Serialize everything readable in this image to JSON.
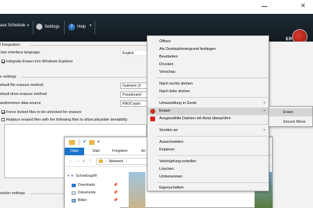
{
  "toolbar": {
    "schedule_label": "ase Schedule",
    "settings_label": "Settings",
    "help_label": "Help",
    "logo_text": "ER"
  },
  "settings": {
    "section_integration": "l Integration",
    "ui_language_label": "Jser interface language:",
    "ui_language_value": "English",
    "integrate_label": "Integrate Eraser into Windows Explorer",
    "section_erase": "e settings",
    "default_file_label": "efault file erasure method",
    "default_file_value": "Gutmann (3",
    "default_drive_label": "efault drive erasure method",
    "default_drive_value": "Pseudorand",
    "randomness_label": "andomness data source",
    "randomness_value": "RNGCrypto",
    "force_unlock_label": "Force locked files to be unlocked for erasure",
    "replace_label": "Replace erased files with the following files to allow plausible deniability",
    "section_scheduler": "eduler settings"
  },
  "explorer": {
    "tab_file": "Datei",
    "tab_start": "Start",
    "tab_share": "Freigeben",
    "tab_view": "An",
    "address": "Netzwerk",
    "nav_items": [
      "Schnellzugriff",
      "Downloads",
      "Dokumente",
      "Bilder"
    ]
  },
  "context_menu": {
    "items": [
      "Öffnen",
      "Als Desktophintergrund festlegen",
      "Bearbeiten",
      "Drucken",
      "Vorschau",
      "Nach rechts drehen",
      "Nach links drehen",
      "Umwandlung in Gerät",
      "Eraser",
      "Ausgewählte Dateien mit Avira überprüfen",
      "Senden an",
      "Ausschneiden",
      "Kopieren",
      "Verknüpfung erstellen",
      "Löschen",
      "Umbenennen",
      "Eigenschaften"
    ],
    "submenu": [
      "Erase",
      "Secure Move"
    ]
  },
  "colors": {
    "toolbar_bg": "#1a242b",
    "accent_blue": "#1a73c8",
    "menu_bg": "#f2f2f2",
    "menu_highlight": "#d4d4d4",
    "logo_red": "#c82a20"
  }
}
